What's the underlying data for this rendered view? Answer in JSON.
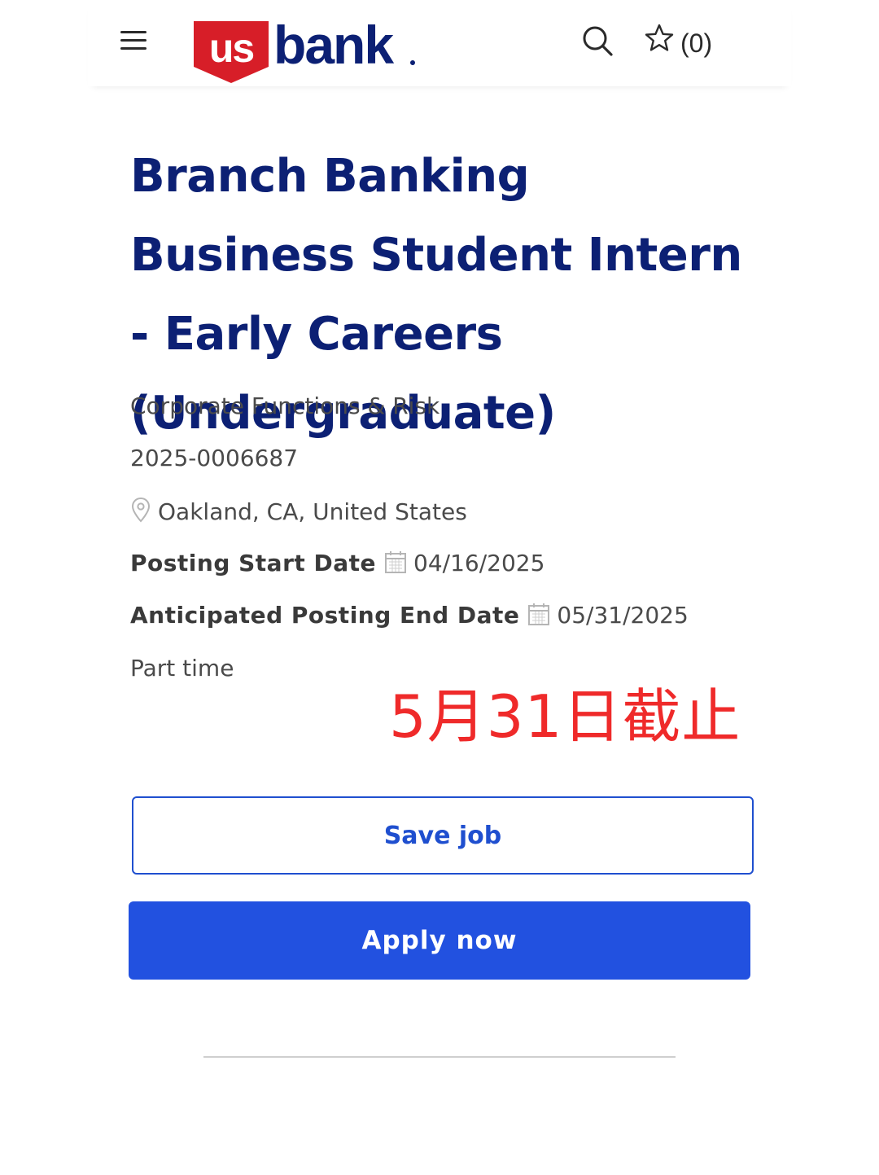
{
  "header": {
    "logo_us": "us",
    "logo_bank": "bank",
    "saved_count": "(0)",
    "icons": [
      "menu-icon",
      "search-icon",
      "star-icon"
    ]
  },
  "job": {
    "title": "Branch Banking Business Student Intern - Early Careers (Undergraduate)",
    "category": "Corporate Functions & Risk",
    "requisition_id": "2025-0006687",
    "location": "Oakland, CA, United States",
    "posting_start_label": "Posting Start Date",
    "posting_start_date": "04/16/2025",
    "posting_end_label": "Anticipated Posting End Date",
    "posting_end_date": "05/31/2025",
    "employment_type": "Part time"
  },
  "annotation": {
    "text": "5月31日截止"
  },
  "actions": {
    "save_label": "Save job",
    "apply_label": "Apply now"
  },
  "colors": {
    "brand_navy": "#0c2074",
    "brand_red": "#d71e28",
    "button_blue": "#2251e0",
    "annotation_red": "#ef2a2a"
  }
}
